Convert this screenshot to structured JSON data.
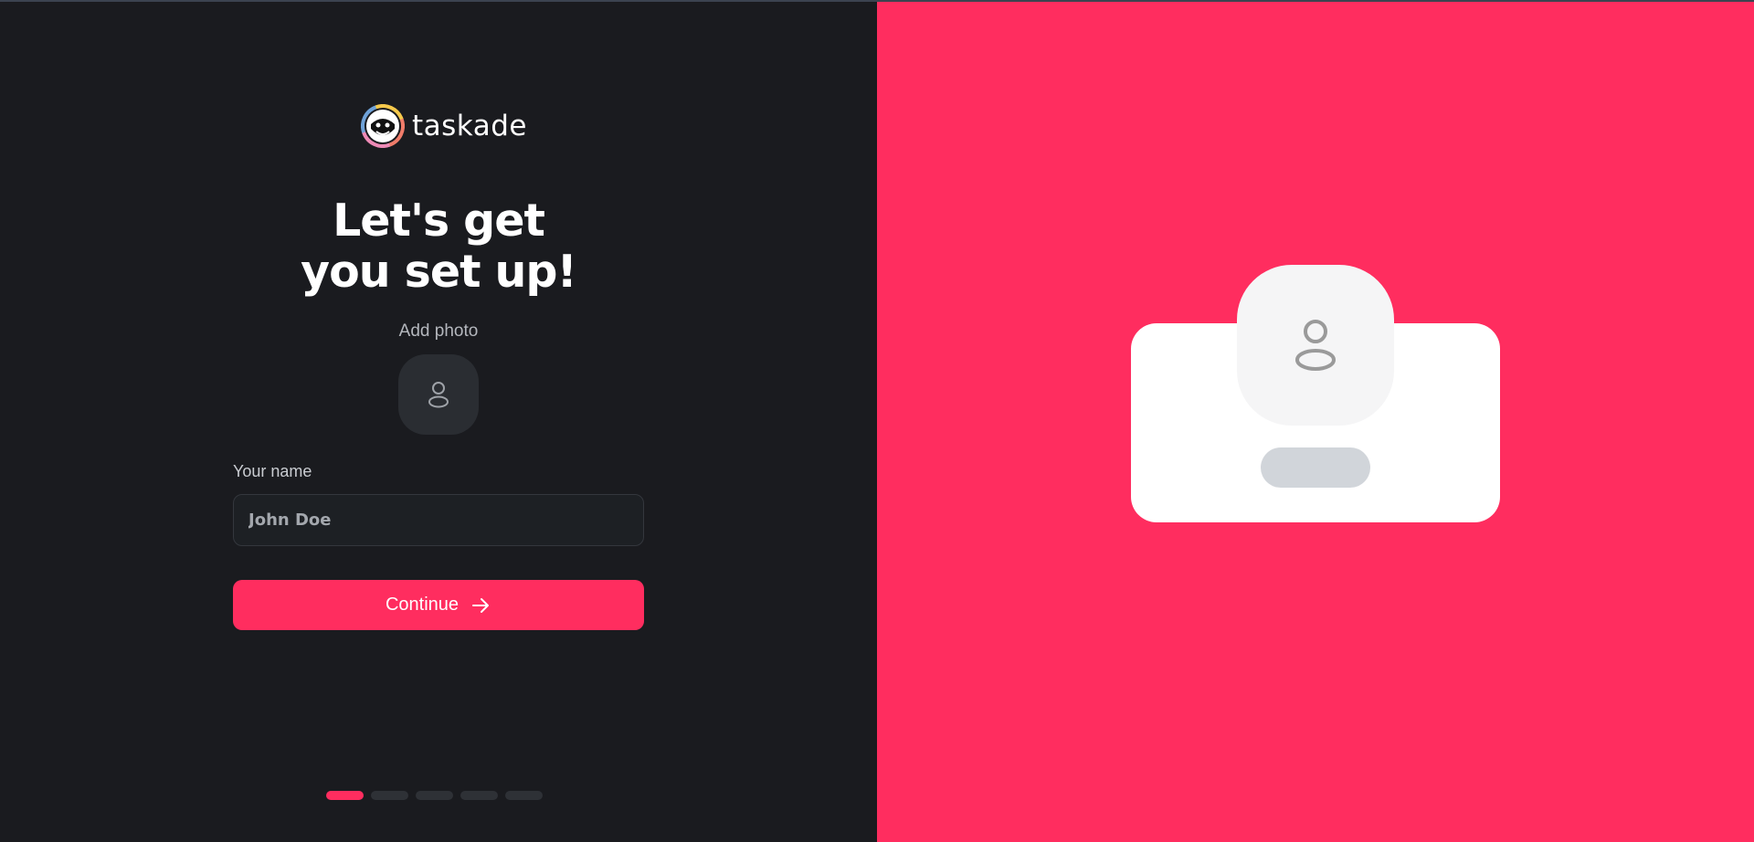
{
  "brand": {
    "name": "taskade",
    "logo_icon": "taskade-logo-icon"
  },
  "heading": {
    "line1": "Let's get",
    "line2": "you set up!"
  },
  "photo": {
    "label": "Add photo",
    "icon": "user-icon"
  },
  "name_field": {
    "label": "Your name",
    "placeholder": "John Doe"
  },
  "continue_button": {
    "label": "Continue",
    "icon": "arrow-right-icon"
  },
  "stepper": {
    "total_steps": 5,
    "current_step": 1
  },
  "illustration": {
    "icon": "user-icon"
  },
  "colors": {
    "accent": "#ff2d5f",
    "background_dark": "#1a1b1f",
    "input_background": "#1d2024",
    "card": "#ffffff"
  }
}
